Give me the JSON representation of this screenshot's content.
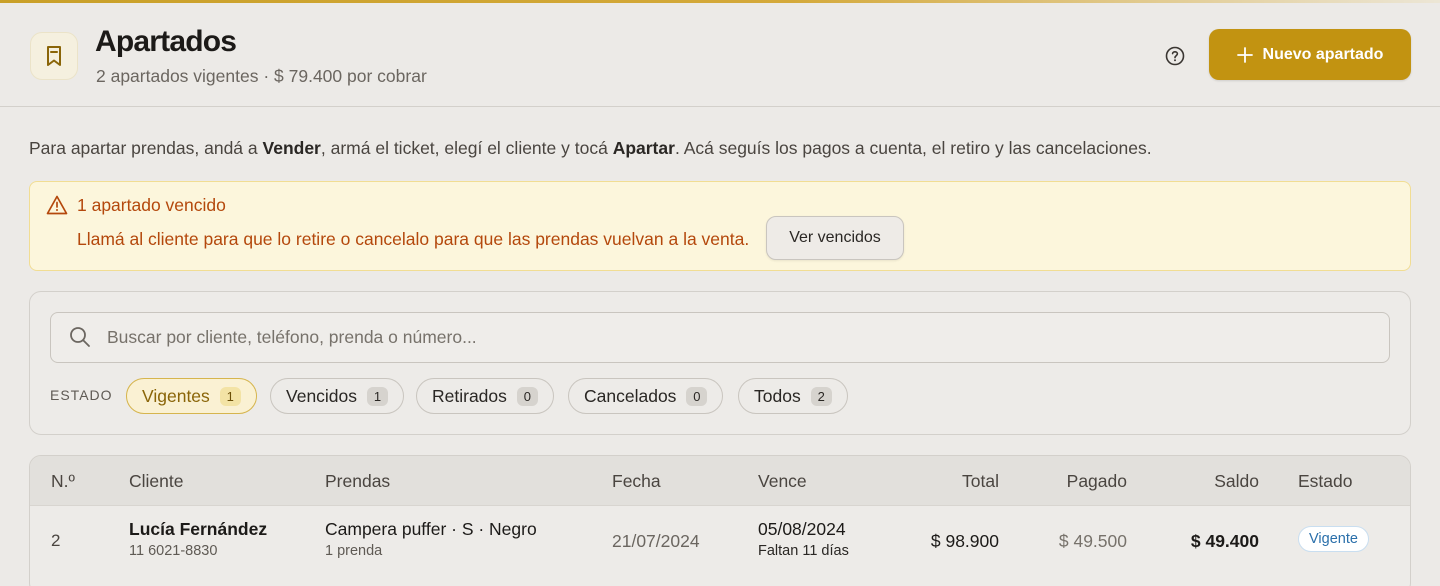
{
  "header": {
    "title": "Apartados",
    "subtitle": "2 apartados vigentes · $ 79.400 por cobrar",
    "icon": "bookmark-icon",
    "new_button_label": "Nuevo apartado",
    "accent": "#c29311"
  },
  "intro": {
    "part1": "Para apartar prendas, andá a ",
    "bold1": "Vender",
    "part2": ", armá el ticket, elegí el cliente y tocá ",
    "bold2": "Apartar",
    "part3": ". Acá seguís los pagos a cuenta, el retiro y las cancelaciones."
  },
  "alert": {
    "title": "1 apartado vencido",
    "text": "Llamá al cliente para que lo retire o cancelalo para que las prendas vuelvan a la venta.",
    "button_label": "Ver vencidos",
    "color": "#b4480c"
  },
  "search": {
    "placeholder": "Buscar por cliente, teléfono, prenda o número..."
  },
  "filters": {
    "label": "ESTADO",
    "chips": [
      {
        "label": "Vigentes",
        "count": "1",
        "active": true
      },
      {
        "label": "Vencidos",
        "count": "1"
      },
      {
        "label": "Retirados",
        "count": "0"
      },
      {
        "label": "Cancelados",
        "count": "0"
      },
      {
        "label": "Todos",
        "count": "2"
      }
    ]
  },
  "table": {
    "columns": [
      "N.º",
      "Cliente",
      "Prendas",
      "Fecha",
      "Vence",
      "Total",
      "Pagado",
      "Saldo",
      "Estado"
    ],
    "rows": [
      {
        "numero": "2",
        "cliente": "Lucía Fernández",
        "telefono": "11 6021-8830",
        "prenda": "Campera puffer · S · Negro",
        "cantidad": "1 prenda",
        "fecha": "21/07/2024",
        "vence": "05/08/2024",
        "faltan": "Faltan 11 días",
        "total": "$ 98.900",
        "pagado": "$ 49.500",
        "saldo": "$ 49.400",
        "estado": "Vigente"
      }
    ]
  }
}
